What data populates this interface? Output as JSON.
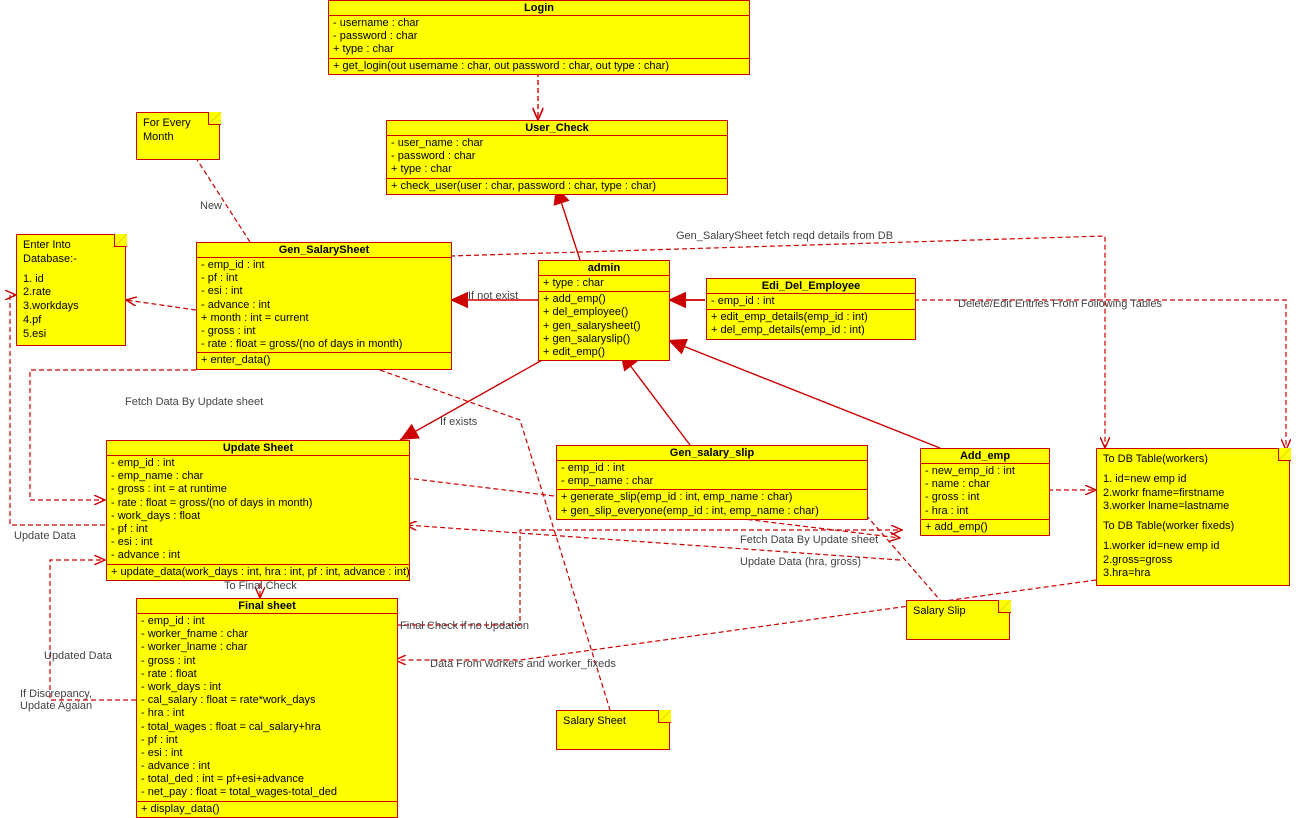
{
  "classes": {
    "login": {
      "title": "Login",
      "attrs": [
        "- username : char",
        "- password : char",
        "+ type : char"
      ],
      "ops": [
        "+ get_login(out username : char, out password : char, out type : char)"
      ]
    },
    "user_check": {
      "title": "User_Check",
      "attrs": [
        "- user_name : char",
        "- password : char",
        "+ type : char"
      ],
      "ops": [
        "+ check_user(user : char, password : char, type : char)"
      ]
    },
    "gen_salarysheet": {
      "title": "Gen_SalarySheet",
      "attrs": [
        "- emp_id : int",
        "- pf : int",
        "- esi : int",
        "- advance : int",
        "+ month : int = current",
        "- gross : int",
        "- rate : float = gross/(no of days in month)"
      ],
      "ops": [
        "+ enter_data()"
      ]
    },
    "admin": {
      "title": "admin",
      "attrs": [
        "+ type : char"
      ],
      "ops": [
        "+ add_emp()",
        "+ del_employee()",
        "+ gen_salarysheet()",
        "+ gen_salaryslip()",
        "+ edit_emp()"
      ]
    },
    "edi_del": {
      "title": "Edi_Del_Employee",
      "attrs": [
        "- emp_id : int"
      ],
      "ops": [
        "+ edit_emp_details(emp_id : int)",
        "+ del_emp_details(emp_id : int)"
      ]
    },
    "update_sheet": {
      "title": "Update Sheet",
      "attrs": [
        "- emp_id : int",
        "- emp_name : char",
        "- gross : int = at runtime",
        "- rate : float = gross/(no of days in month)",
        "- work_days : float",
        "- pf : int",
        "- esi : int",
        "- advance : int"
      ],
      "ops": [
        "+ update_data(work_days : int, hra : int, pf : int, advance : int)"
      ]
    },
    "gen_salary_slip": {
      "title": "Gen_salary_slip",
      "attrs": [
        "- emp_id : int",
        "- emp_name : char"
      ],
      "ops": [
        "+ generate_slip(emp_id : int, emp_name : char)",
        "+ gen_slip_everyone(emp_id : int, emp_name : char)"
      ]
    },
    "add_emp": {
      "title": "Add_emp",
      "attrs": [
        "- new_emp_id : int",
        "- name : char",
        "- gross : int",
        "- hra : int"
      ],
      "ops": [
        "+ add_emp()"
      ]
    },
    "final_sheet": {
      "title": "Final sheet",
      "attrs": [
        "- emp_id : int",
        "- worker_fname : char",
        "- worker_lname : char",
        "- gross : int",
        "- rate : float",
        "- work_days : int",
        "- cal_salary : float = rate*work_days",
        "- hra : int",
        "- total_wages : float = cal_salary+hra",
        "- pf : int",
        "- esi : int",
        "- advance : int",
        "- total_ded : int = pf+esi+advance",
        "- net_pay : float = total_wages-total_ded"
      ],
      "ops": [
        "+ display_data()"
      ]
    }
  },
  "notes": {
    "every_month": "For Every Month",
    "enter_db": {
      "head": "Enter Into Database:-",
      "items": [
        "1. id",
        "2.rate",
        "3.workdays",
        "4.pf",
        "5.esi"
      ]
    },
    "db_tables": {
      "head1": "To DB Table(workers)",
      "items1": [
        "1. id=new emp id",
        "2.workr fname=firstname",
        "3.worker lname=lastname"
      ],
      "head2": "To DB Table(worker fixeds)",
      "items2": [
        "1.worker id=new emp id",
        "2.gross=gross",
        "3.hra=hra"
      ]
    },
    "salary_slip": "Salary Slip",
    "salary_sheet": "Salary Sheet"
  },
  "labels": {
    "new": "New",
    "if_not_exist": "If not exist",
    "if_exists": "If exists",
    "fetch_gen": "Gen_SalarySheet fetch reqd details from DB",
    "fetch_update": "Fetch Data By Update sheet",
    "fetch_update2": "Fetch Data By Update sheet",
    "update_data": "Update Data",
    "update_data_hra": "Update Data (hra, gross)",
    "updated_data": "Updated Data",
    "discrepancy": "If Discrepancy, Update Agaian",
    "to_final_check": "To Final Check",
    "final_check_no": "Final Check if no Updation",
    "data_from_workers": "Data From workers and worker_fixeds",
    "delete_edit": "Delete/Edit Entries From Following Tables"
  }
}
